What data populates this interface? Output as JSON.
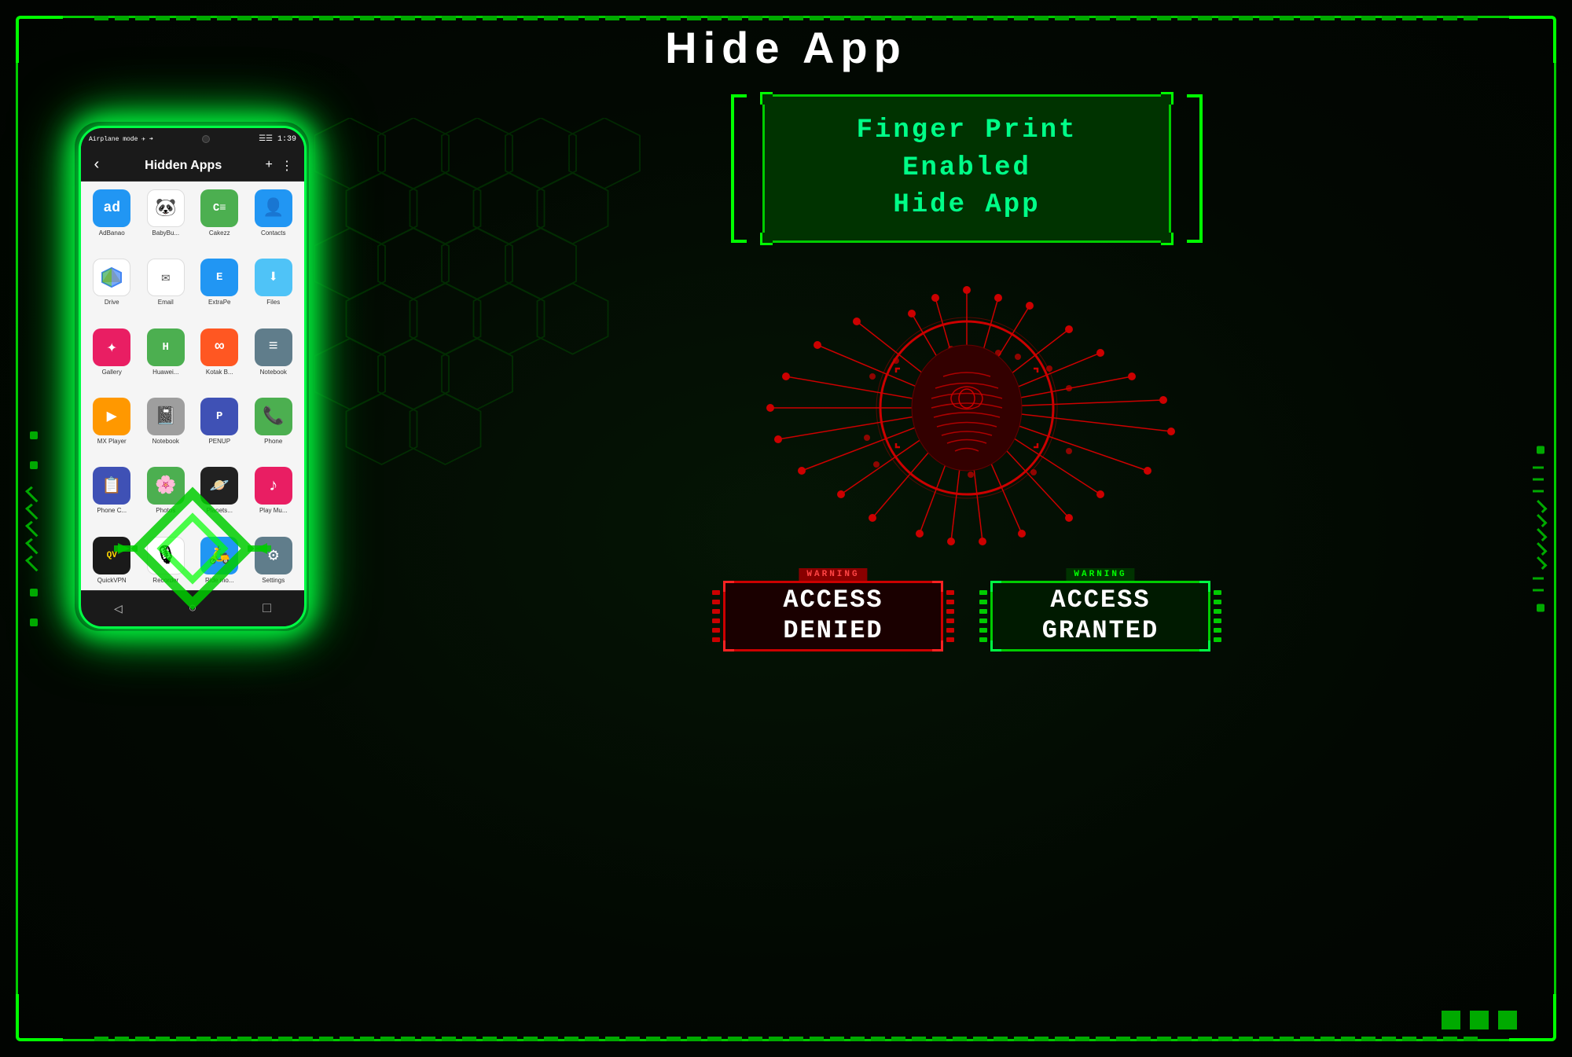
{
  "page": {
    "title": "Hide App",
    "background_color": "#020e02",
    "accent_color": "#00ff00",
    "danger_color": "#cc0000"
  },
  "phone": {
    "status_bar": {
      "left": "Airplane mode ✈ ➜",
      "camera": "●",
      "right": "☰☰ 1:39"
    },
    "header": {
      "back": "‹",
      "title": "Hidden Apps",
      "add": "+",
      "menu": "⋮"
    },
    "apps": [
      {
        "label": "AdBanao",
        "icon": "ad",
        "color": "app-adbannao"
      },
      {
        "label": "BabyBu...",
        "icon": "🐼",
        "color": "app-babyboo"
      },
      {
        "label": "Cakezz",
        "icon": "C",
        "color": "app-cakezz"
      },
      {
        "label": "Contacts",
        "icon": "👤",
        "color": "app-contacts"
      },
      {
        "label": "Drive",
        "icon": "▲",
        "color": "app-drive"
      },
      {
        "label": "Email",
        "icon": "✉",
        "color": "app-email"
      },
      {
        "label": "ExtraPe",
        "icon": "E",
        "color": "app-extrape"
      },
      {
        "label": "Files",
        "icon": "⬇",
        "color": "app-files"
      },
      {
        "label": "Gallery",
        "icon": "✦",
        "color": "app-gallery"
      },
      {
        "label": "Huawei...",
        "icon": "H",
        "color": "app-huawei"
      },
      {
        "label": "Kotak B...",
        "icon": "∞",
        "color": "app-kotak"
      },
      {
        "label": "Notebook",
        "icon": "≡",
        "color": "app-notebook"
      },
      {
        "label": "MX Player",
        "icon": "▶",
        "color": "app-mxplayer"
      },
      {
        "label": "Notebook",
        "icon": "📓",
        "color": "app-notebook2"
      },
      {
        "label": "PENUP",
        "icon": "P",
        "color": "app-penup"
      },
      {
        "label": "Phone",
        "icon": "📞",
        "color": "app-phone"
      },
      {
        "label": "Phone C...",
        "icon": "📋",
        "color": "app-phonec"
      },
      {
        "label": "Photos",
        "icon": "🌸",
        "color": "app-photos"
      },
      {
        "label": "Planets...",
        "icon": "🪐",
        "color": "app-planets"
      },
      {
        "label": "Play Mu...",
        "icon": "♪",
        "color": "app-playmu"
      },
      {
        "label": "QuickVPN",
        "icon": "QV",
        "color": "app-quickvpn"
      },
      {
        "label": "Recorder",
        "icon": "🎙",
        "color": "app-recorder"
      },
      {
        "label": "Ride mo...",
        "icon": "S",
        "color": "app-ridem"
      },
      {
        "label": "Settings",
        "icon": "⚙",
        "color": "app-settings"
      }
    ],
    "nav": [
      "◁",
      "○",
      "□"
    ]
  },
  "fingerprint_panel": {
    "title_line1": "Finger Print Enabled",
    "title_line2": "Hide App"
  },
  "badges": {
    "denied": {
      "warning": "WARNING",
      "text_line1": "ACCESS",
      "text_line2": "DENIED"
    },
    "granted": {
      "warning": "WARNING",
      "text_line1": "ACCESS",
      "text_line2": "GRANTED"
    }
  }
}
